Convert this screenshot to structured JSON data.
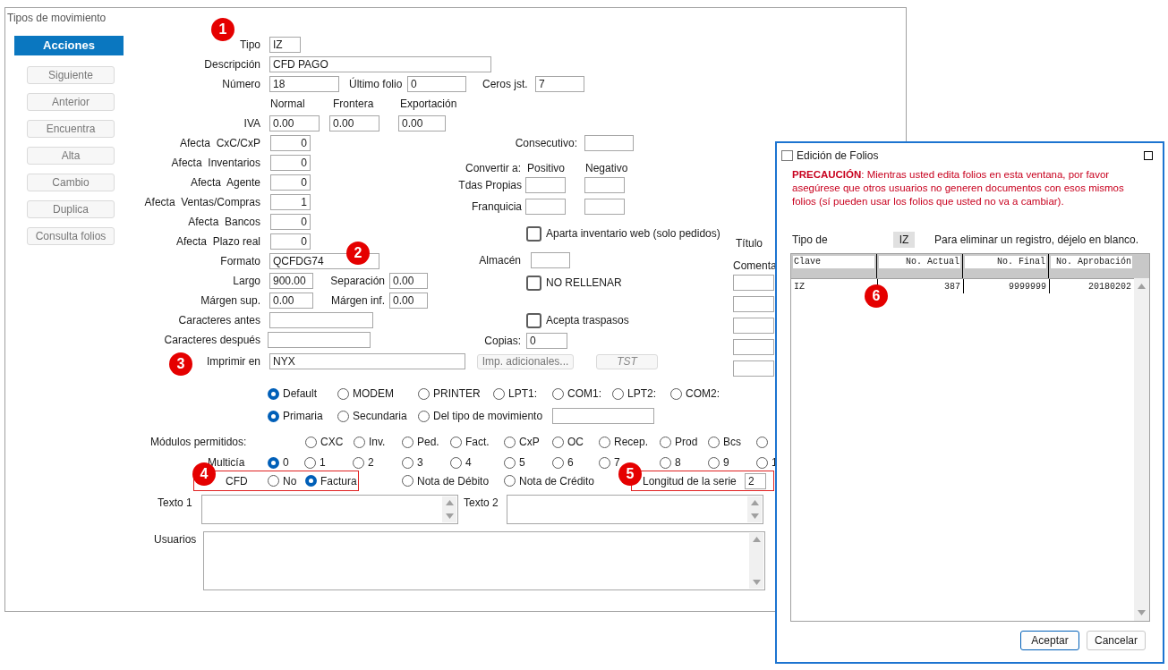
{
  "window": {
    "title": "Tipos de movimiento"
  },
  "sidebar": {
    "header": "Acciones",
    "buttons": [
      {
        "label": "Siguiente",
        "disabled": true
      },
      {
        "label": "Anterior",
        "disabled": true
      },
      {
        "label": "Encuentra",
        "disabled": true
      },
      {
        "label": "Alta",
        "disabled": true
      },
      {
        "label": "Cambio",
        "disabled": true
      },
      {
        "label": "Duplica",
        "disabled": true
      },
      {
        "label": "Consulta folios",
        "disabled": true
      }
    ]
  },
  "form": {
    "tipo": {
      "label": "Tipo",
      "value": "IZ"
    },
    "descripcion": {
      "label": "Descripción",
      "value": "CFD PAGO"
    },
    "numero": {
      "label": "Número",
      "value": "18"
    },
    "ultimo_folio": {
      "label": "Último folio",
      "value": "0"
    },
    "ceros": {
      "label": "Ceros jst.",
      "value": "7"
    },
    "iva": {
      "label": "IVA",
      "columns": [
        "Normal",
        "Frontera",
        "Exportación"
      ],
      "values": [
        "0.00",
        "0.00",
        "0.00"
      ]
    },
    "afecta": [
      {
        "label": "Afecta  CxC/CxP",
        "value": "0"
      },
      {
        "label": "Afecta  Inventarios",
        "value": "0"
      },
      {
        "label": "Afecta  Agente",
        "value": "0"
      },
      {
        "label": "Afecta  Ventas/Compras",
        "value": "1"
      },
      {
        "label": "Afecta  Bancos",
        "value": "0"
      },
      {
        "label": "Afecta  Plazo real",
        "value": "0"
      }
    ],
    "formato": {
      "label": "Formato",
      "value": "QCFDG74"
    },
    "largo": {
      "label": "Largo",
      "value": "900.00"
    },
    "separacion": {
      "label": "Separación",
      "value": "0.00"
    },
    "margen_sup": {
      "label": "Márgen sup.",
      "value": "0.00"
    },
    "margen_inf": {
      "label": "Márgen inf.",
      "value": "0.00"
    },
    "caracteres_antes": {
      "label": "Caracteres antes"
    },
    "caracteres_despues": {
      "label": "Caracteres después"
    },
    "imprimir_en": {
      "label": "Imprimir en",
      "value": "NYX"
    },
    "imp_adicionales": {
      "label": "Imp. adicionales...",
      "disabled": true
    },
    "tst": {
      "label": "TST",
      "disabled": true
    },
    "consecutivo": {
      "label": "Consecutivo:"
    },
    "convertir": {
      "label": "Convertir a:",
      "columns": [
        "Positivo",
        "Negativo"
      ],
      "rows": [
        {
          "label": "Tdas Propias"
        },
        {
          "label": "Franquicia"
        }
      ]
    },
    "aparta": {
      "label": "Aparta inventario web (solo pedidos)",
      "checked": false
    },
    "almacen": {
      "label": "Almacén"
    },
    "no_rellenar": {
      "label": "NO RELLENAR",
      "checked": false
    },
    "acepta_traspasos": {
      "label": "Acepta traspasos",
      "checked": false
    },
    "copias": {
      "label": "Copias:",
      "value": "0"
    },
    "titulo": {
      "label": "Título"
    },
    "comentarios": {
      "label": "Comenta"
    },
    "port_options": [
      {
        "label": "Default",
        "selected": true
      },
      {
        "label": "MODEM",
        "selected": false
      },
      {
        "label": "PRINTER",
        "selected": false
      },
      {
        "label": "LPT1:",
        "selected": false
      },
      {
        "label": "COM1:",
        "selected": false
      },
      {
        "label": "LPT2:",
        "selected": false
      },
      {
        "label": "COM2:",
        "selected": false
      }
    ],
    "source_options": [
      {
        "label": "Primaria",
        "selected": true
      },
      {
        "label": "Secundaria",
        "selected": false
      },
      {
        "label": "Del tipo de movimiento",
        "selected": false
      }
    ],
    "modulos": {
      "label": "Módulos permitidos:",
      "options": [
        {
          "label": "CXC",
          "selected": false
        },
        {
          "label": "Inv.",
          "selected": false
        },
        {
          "label": "Ped.",
          "selected": false
        },
        {
          "label": "Fact.",
          "selected": false
        },
        {
          "label": "CxP",
          "selected": false
        },
        {
          "label": "OC",
          "selected": false
        },
        {
          "label": "Recep.",
          "selected": false
        },
        {
          "label": "Prod",
          "selected": false
        },
        {
          "label": "Bcs",
          "selected": false
        },
        {
          "selected": false
        }
      ]
    },
    "multicia": {
      "label": "Multicía",
      "options": [
        {
          "label": "0",
          "selected": true
        },
        {
          "label": "1",
          "selected": false
        },
        {
          "label": "2",
          "selected": false
        },
        {
          "label": "3",
          "selected": false
        },
        {
          "label": "4",
          "selected": false
        },
        {
          "label": "5",
          "selected": false
        },
        {
          "label": "6",
          "selected": false
        },
        {
          "label": "7",
          "selected": false
        },
        {
          "label": "8",
          "selected": false
        },
        {
          "label": "9",
          "selected": false
        },
        {
          "label": "1",
          "selected": false
        }
      ]
    },
    "cfd": {
      "label": "CFD",
      "options": [
        {
          "label": "No",
          "selected": false
        },
        {
          "label": "Factura",
          "selected": true
        },
        {
          "label": "Nota de Débito",
          "selected": false
        },
        {
          "label": "Nota de Crédito",
          "selected": false
        }
      ]
    },
    "longitud_serie": {
      "label": "Longitud de la serie",
      "value": "2"
    },
    "texto1": {
      "label": "Texto 1"
    },
    "texto2": {
      "label": "Texto 2"
    },
    "usuarios": {
      "label": "Usuarios"
    }
  },
  "dialog": {
    "title": "Edición de Folios",
    "warning": "**PRECAUCIÓN**: Mientras usted edita folios en esta ventana, por favor asegúrese que otros usuarios no generen documentos con esos mismos folios  (sí pueden usar los folios que usted no va a cambiar).",
    "tipo_label": "Tipo de",
    "tipo_value": "IZ",
    "note": "Para eliminar un registro, déjelo en blanco.",
    "columns": [
      "Clave",
      "No. Actual",
      "No. Final",
      "No. Aprobación"
    ],
    "rows": [
      [
        "IZ",
        "387",
        "9999999",
        "20180202"
      ]
    ],
    "buttons": [
      "Aceptar",
      "Cancelar"
    ]
  },
  "callouts": [
    "1",
    "2",
    "3",
    "4",
    "5",
    "6"
  ]
}
